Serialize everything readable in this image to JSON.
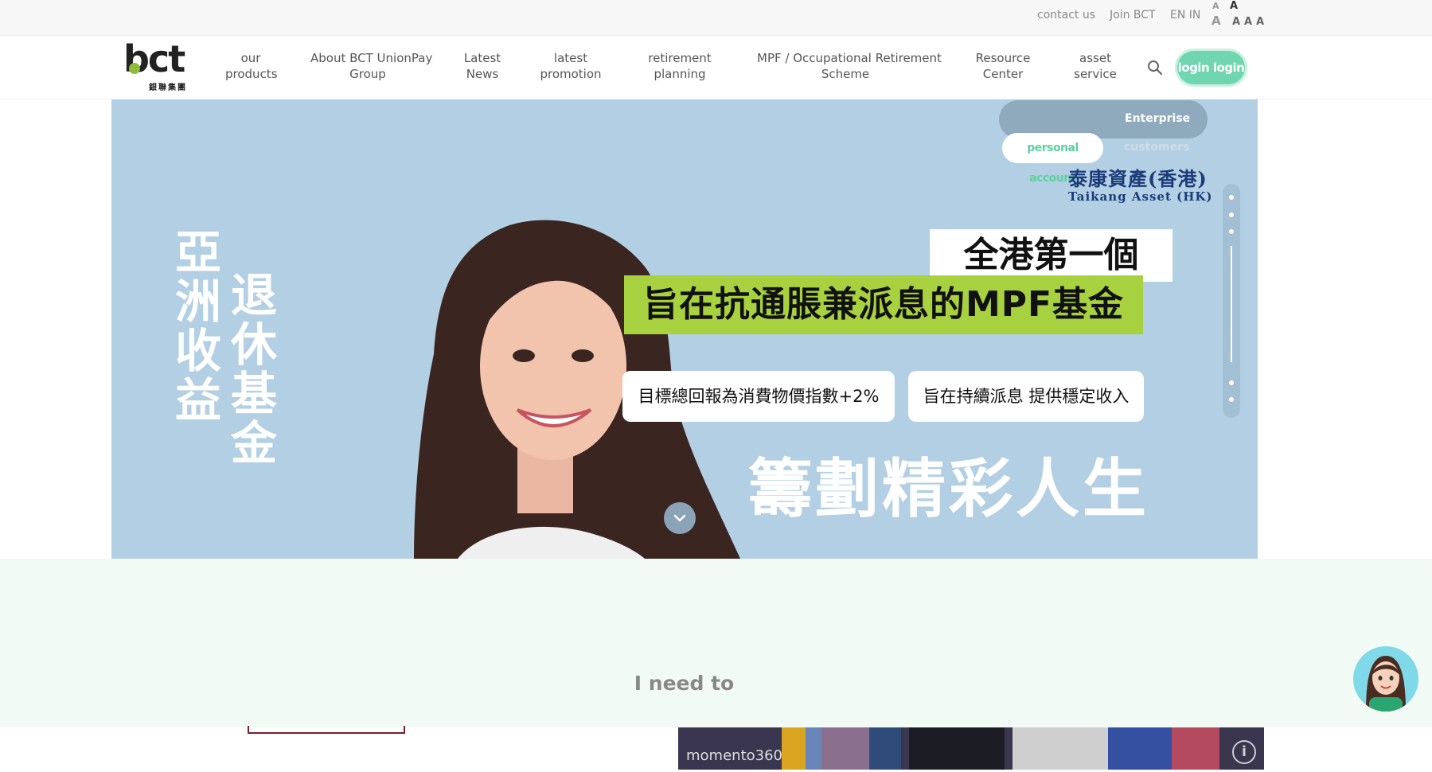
{
  "topbar": {
    "contact": "contact us",
    "join": "Join BCT",
    "lang": "EN IN",
    "font_sizes": [
      "A",
      "A",
      "A",
      "A",
      "A",
      "A"
    ]
  },
  "logo": {
    "word": "bct",
    "sub": "銀聯集團"
  },
  "nav": [
    "our\nproducts",
    "About BCT UnionPay\nGroup",
    "Latest\nNews",
    "latest\npromotion",
    "retirement\nplanning",
    "MPF / Occupational Retirement\nScheme",
    "Resource\nCenter",
    "asset\nservice"
  ],
  "icons": {
    "search": "search-icon",
    "scroll": "chevron-down-icon",
    "chat": "chat-avatar-icon",
    "info": "info-icon"
  },
  "login": "login login",
  "account_switch": {
    "enterprise": "Enterprise",
    "personal": "personal account",
    "customers": "customers"
  },
  "hero": {
    "vertical_right": "退休基金",
    "vertical_left": "亞洲收益",
    "brand_cn": "泰康資產(香港)",
    "brand_en": "Taikang Asset (HK)",
    "headline_top": "全港第一個",
    "headline_main": "旨在抗通脹兼派息的MPF基金",
    "pill_left": "目標總回報為消費物價指數+2%",
    "pill_right": "旨在持續派息 提供穩定收入",
    "slogan": "籌劃精彩人生"
  },
  "section": {
    "heading": "I need to"
  },
  "video": {
    "watermark": "momento360",
    "info": "i"
  },
  "colors": {
    "accent": "#6fd6b1",
    "hero_bg": "#b3cfe3",
    "green_band": "#a8d13f",
    "mint_bg": "#f1faf5",
    "brand_navy": "#1c3b7a"
  }
}
